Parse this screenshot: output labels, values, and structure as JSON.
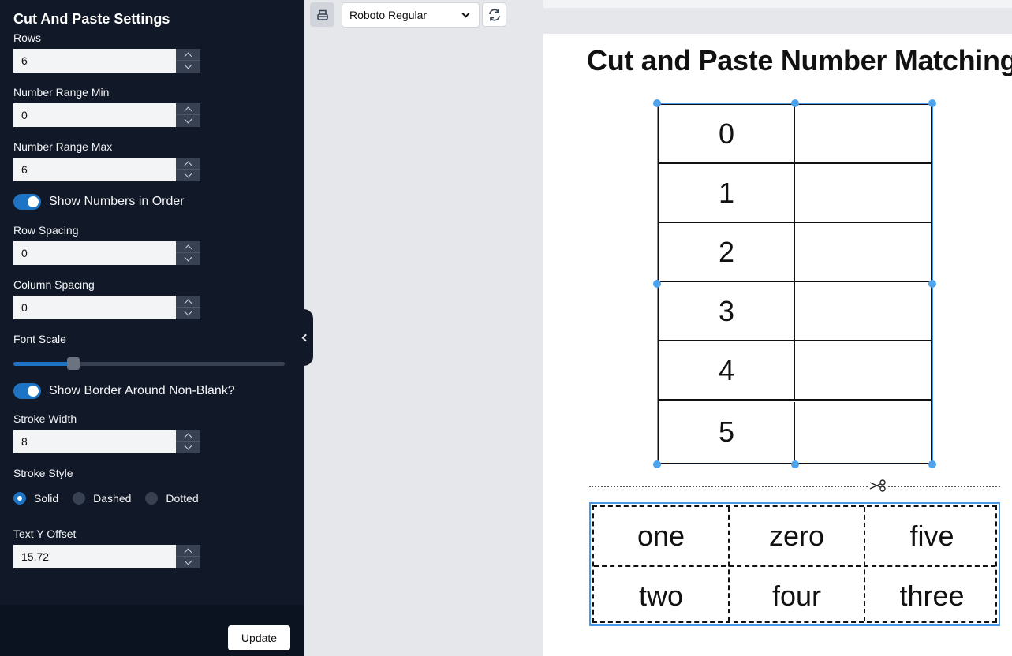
{
  "sidebar": {
    "title": "Cut And Paste Settings",
    "rows": {
      "label": "Rows",
      "value": "6"
    },
    "range_min": {
      "label": "Number Range Min",
      "value": "0"
    },
    "range_max": {
      "label": "Number Range Max",
      "value": "6"
    },
    "show_numbers_in_order": {
      "label": "Show Numbers in Order",
      "on": true
    },
    "row_spacing": {
      "label": "Row Spacing",
      "value": "0"
    },
    "column_spacing": {
      "label": "Column Spacing",
      "value": "0"
    },
    "font_scale": {
      "label": "Font Scale",
      "fraction": 0.22
    },
    "show_border": {
      "label": "Show Border Around Non-Blank?",
      "on": true
    },
    "stroke_width": {
      "label": "Stroke Width",
      "value": "8"
    },
    "stroke_style": {
      "label": "Stroke Style",
      "options": [
        "Solid",
        "Dashed",
        "Dotted"
      ],
      "selected": "Solid"
    },
    "text_y_offset": {
      "label": "Text Y Offset",
      "value": "15.72"
    },
    "update_label": "Update"
  },
  "toolbar": {
    "font_select": "Roboto Regular"
  },
  "worksheet": {
    "title": "Cut and Paste Number Matching",
    "numbers": [
      "0",
      "1",
      "2",
      "3",
      "4",
      "5"
    ],
    "cards": [
      [
        "one",
        "zero",
        "five"
      ],
      [
        "two",
        "four",
        "three"
      ]
    ]
  },
  "colors": {
    "sidebar_bg": "#111827",
    "accent": "#1d74c5",
    "selection": "#4da3ee"
  }
}
